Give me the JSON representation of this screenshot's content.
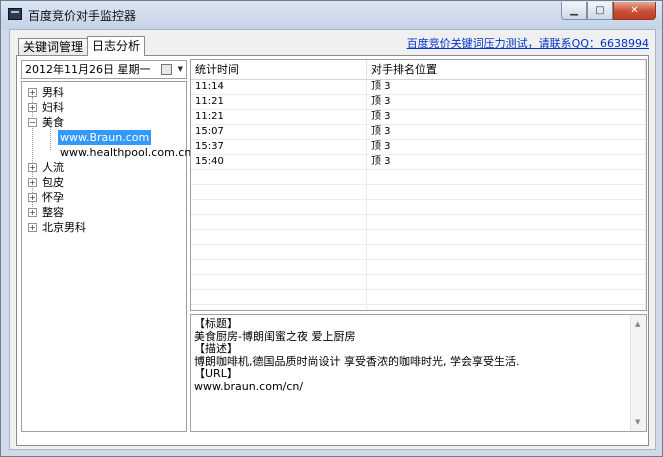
{
  "window": {
    "title": "百度竞价对手监控器",
    "minimize_glyph": "▁",
    "maximize_glyph": "□",
    "close_glyph": "✕"
  },
  "tabs": [
    {
      "label": "关键词管理",
      "active": false
    },
    {
      "label": "日志分析",
      "active": true
    }
  ],
  "promo_link": "百度竞价关键词压力测试，请联系QQ：6638994",
  "date_picker": {
    "value": "2012年11月26日 星期一",
    "icon": "calendar-icon",
    "arrow": "▼"
  },
  "tree": {
    "expand_glyph": "+",
    "collapse_glyph": "−",
    "items": [
      {
        "label": "男科",
        "expanded": false
      },
      {
        "label": "妇科",
        "expanded": false
      },
      {
        "label": "美食",
        "expanded": true,
        "children": [
          {
            "label": "www.Braun.com",
            "selected": true
          },
          {
            "label": "www.healthpool.com.cn",
            "selected": false
          }
        ]
      },
      {
        "label": "人流",
        "expanded": false
      },
      {
        "label": "包皮",
        "expanded": false
      },
      {
        "label": "怀孕",
        "expanded": false
      },
      {
        "label": "整容",
        "expanded": false
      },
      {
        "label": "北京男科",
        "expanded": false
      }
    ]
  },
  "grid": {
    "columns": [
      "统计时间",
      "对手排名位置"
    ],
    "rows": [
      [
        "11:14",
        "顶 3"
      ],
      [
        "11:21",
        "顶 3"
      ],
      [
        "11:21",
        "顶 3"
      ],
      [
        "15:07",
        "顶 3"
      ],
      [
        "15:37",
        "顶 3"
      ],
      [
        "15:40",
        "顶 3"
      ]
    ],
    "empty_rows": 10
  },
  "detail": {
    "lines": [
      "【标题】",
      "美食厨房-博朗闺蜜之夜 爱上厨房",
      "【描述】",
      "博朗咖啡机,德国品质时尚设计 享受香浓的咖啡时光, 学会享受生活.",
      "【URL】",
      "www.braun.com/cn/"
    ],
    "scroll_up": "▲",
    "scroll_down": "▼"
  },
  "colors": {
    "selection": "#3399ff",
    "link": "#0033cc",
    "close_button": "#c74f36"
  }
}
